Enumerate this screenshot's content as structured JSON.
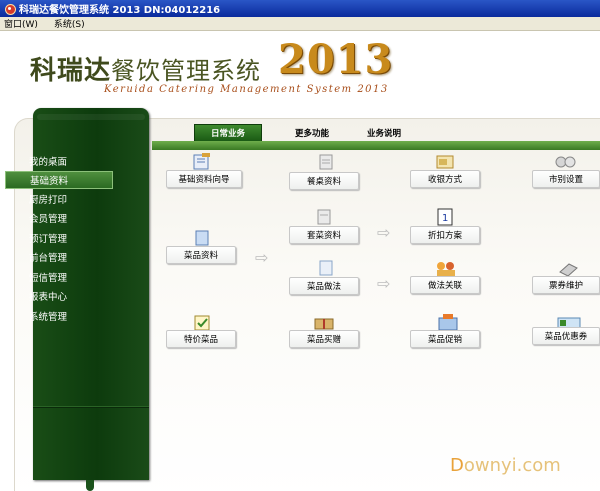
{
  "window": {
    "title": "科瑞达餐饮管理系统 2013 DN:04012216"
  },
  "menu": {
    "items": [
      "窗口(W)",
      "系统(S)"
    ]
  },
  "logo": {
    "cn_a": "科瑞达",
    "cn_b": "餐饮管理系统",
    "year": "2013",
    "en": "Keruida Catering Management System 2013"
  },
  "sidebar": {
    "items": [
      "我的桌面",
      "基础资料",
      "厨房打印",
      "会员管理",
      "预订管理",
      "前台管理",
      "短信管理",
      "报表中心",
      "系统管理"
    ],
    "active": "基础资料"
  },
  "tabs": {
    "items": [
      "日常业务",
      "更多功能",
      "业务说明"
    ],
    "active": "日常业务"
  },
  "functions": {
    "basic_wizard": "基础资料向导",
    "table_info": "餐桌资料",
    "payment": "收银方式",
    "market_settings": "市别设置",
    "dish_info": "菜品资料",
    "set_menu": "套菜资料",
    "discount": "折扣方案",
    "cooking": "菜品做法",
    "cooking_link": "做法关联",
    "coupon_maint": "票券维护",
    "special_dish": "特价菜品",
    "dish_gift": "菜品买赠",
    "dish_promo": "菜品促销",
    "dish_coupon": "菜品优惠券"
  },
  "icons": [
    "app-icon",
    "wizard-icon",
    "table-icon",
    "payment-icon",
    "market-icon",
    "dish-icon",
    "set-menu-icon",
    "discount-icon",
    "cooking-icon",
    "cooking-link-icon",
    "coupon-icon",
    "special-icon",
    "gift-icon",
    "promo-icon",
    "dish-coupon-icon",
    "arrow-right-icon"
  ],
  "watermark": {
    "a": "D",
    "b": "ownyi.com"
  },
  "colors": {
    "sidebar": "#0d3b0d",
    "tab_active": "#2e7a24",
    "title_bar": "#0a2a9c",
    "logo_year": "#c88a1c"
  }
}
